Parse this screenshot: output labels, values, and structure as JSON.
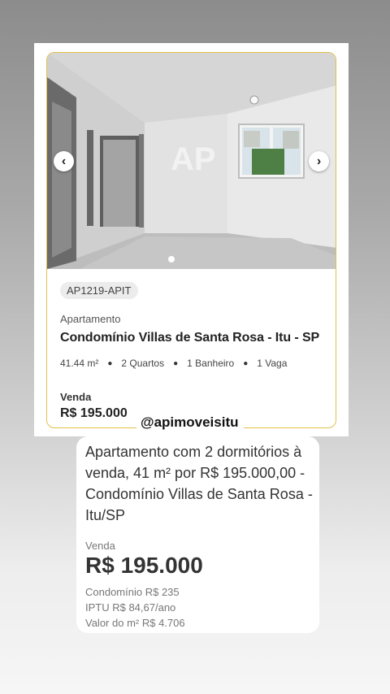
{
  "listing_card": {
    "code": "AP1219-APIT",
    "property_type": "Apartamento",
    "title": "Condomínio Villas de Santa Rosa - Itu - SP",
    "features": [
      "41.44 m²",
      "2 Quartos",
      "1 Banheiro",
      "1 Vaga"
    ],
    "sale_label": "Venda",
    "price": "R$ 195.000",
    "image": {
      "watermark": "AP",
      "slide_count": 1,
      "active_slide": 1,
      "prev_icon": "chevron-left-icon",
      "next_icon": "chevron-right-icon"
    },
    "border_color": "#e2c04a"
  },
  "social": {
    "handle": "@apimoveisitu"
  },
  "details": {
    "title": "Apartamento com 2 dormitórios à venda, 41 m² por R$ 195.000,00 - Condomínio Villas de Santa Rosa - Itu/SP",
    "sale_label": "Venda",
    "price": "R$ 195.000",
    "condo_fee": "Condomínio R$ 235",
    "iptu": "IPTU R$ 84,67/ano",
    "price_per_m2": "Valor do m² R$ 4.706"
  }
}
